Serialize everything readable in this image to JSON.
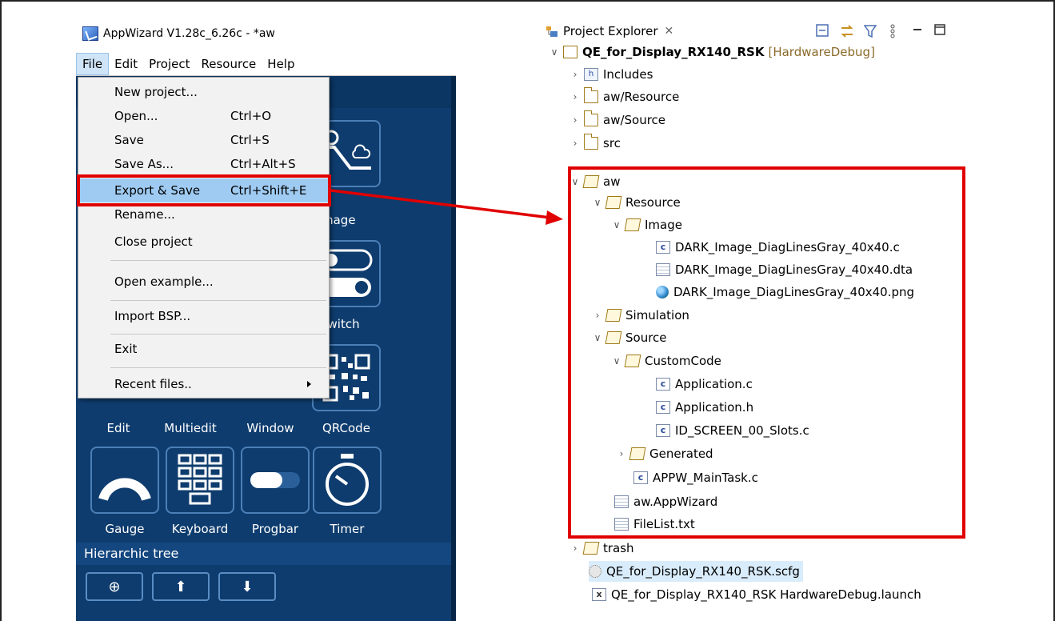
{
  "appwizard": {
    "title": "AppWizard V1.28c_6.26c - *aw",
    "menu": [
      "File",
      "Edit",
      "Project",
      "Resource",
      "Help"
    ],
    "file_menu": [
      {
        "label": "New project...",
        "shortcut": ""
      },
      {
        "label": "Open...",
        "shortcut": "Ctrl+O"
      },
      {
        "label": "Save",
        "shortcut": "Ctrl+S"
      },
      {
        "label": "Save As...",
        "shortcut": "Ctrl+Alt+S"
      },
      {
        "label": "Export & Save",
        "shortcut": "Ctrl+Shift+E"
      },
      {
        "label": "Rename...",
        "shortcut": ""
      },
      {
        "label": "Close project",
        "shortcut": ""
      },
      {
        "label": "Open example...",
        "shortcut": ""
      },
      {
        "label": "Import BSP...",
        "shortcut": ""
      },
      {
        "label": "Exit",
        "shortcut": ""
      },
      {
        "label": "Recent files..",
        "shortcut": ""
      }
    ],
    "widgets_partial": [
      "mage",
      "Switch"
    ],
    "widget_labels_row3": [
      "Edit",
      "Multiedit",
      "Window",
      "QRCode"
    ],
    "widget_labels_row4": [
      "Gauge",
      "Keyboard",
      "Progbar",
      "Timer"
    ],
    "hier_title": "Hierarchic tree",
    "hier_buttons": [
      "⊕",
      "⬆",
      "⬇"
    ]
  },
  "explorer": {
    "tab_title": "Project Explorer",
    "project_name": "QE_for_Display_RX140_RSK",
    "project_config": "[HardwareDebug]",
    "items": {
      "includes": "Includes",
      "aw_resource": "aw/Resource",
      "aw_source": "aw/Source",
      "src": "src",
      "aw": "aw",
      "resource": "Resource",
      "image": "Image",
      "img_c": "DARK_Image_DiagLinesGray_40x40.c",
      "img_dta": "DARK_Image_DiagLinesGray_40x40.dta",
      "img_png": "DARK_Image_DiagLinesGray_40x40.png",
      "simulation": "Simulation",
      "source": "Source",
      "customcode": "CustomCode",
      "app_c": "Application.c",
      "app_h": "Application.h",
      "slots_c": "ID_SCREEN_00_Slots.c",
      "generated": "Generated",
      "maintask_c": "APPW_MainTask.c",
      "aw_appwizard": "aw.AppWizard",
      "filelist": "FileList.txt",
      "trash": "trash",
      "scfg": "QE_for_Display_RX140_RSK.scfg",
      "launch": "QE_for_Display_RX140_RSK HardwareDebug.launch"
    }
  },
  "colors": {
    "aw_background": "#0e3c6e",
    "highlight": "#9fcbf2",
    "callout_red": "#e00000"
  }
}
